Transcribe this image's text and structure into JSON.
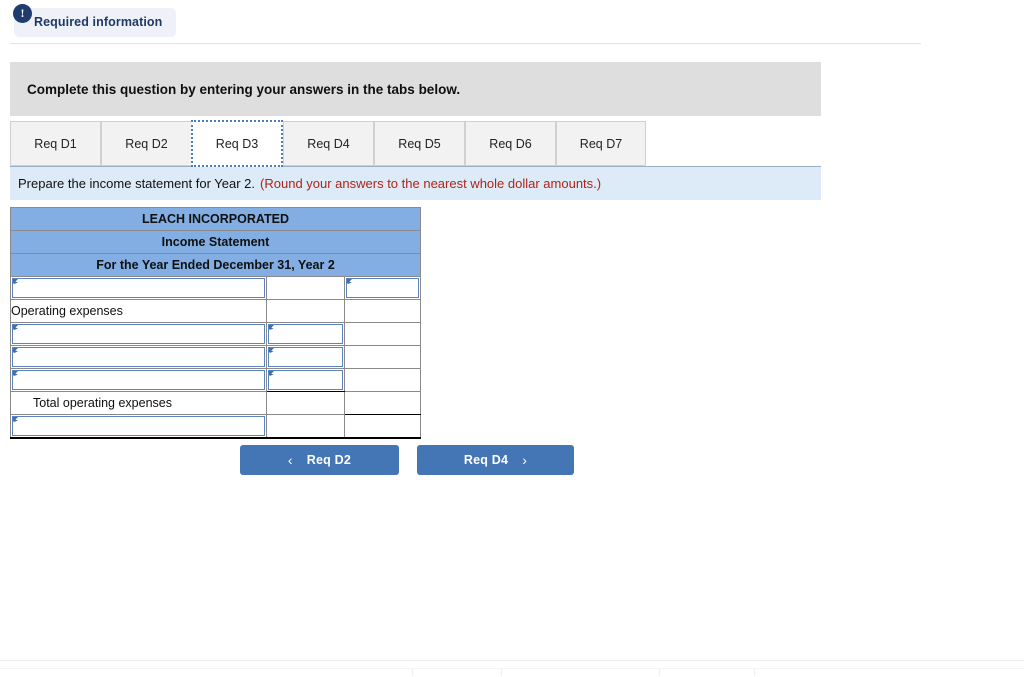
{
  "badge": {
    "icon": "exclamation-icon",
    "icon_glyph": "!",
    "label": "Required information"
  },
  "question_header": {
    "text": "Complete this question by entering your answers in the tabs below."
  },
  "tabs": {
    "active_index": 2,
    "items": [
      {
        "label": "Req D1"
      },
      {
        "label": "Req D2"
      },
      {
        "label": "Req D3"
      },
      {
        "label": "Req D4"
      },
      {
        "label": "Req D5"
      },
      {
        "label": "Req D6"
      },
      {
        "label": "Req D7"
      }
    ]
  },
  "instruction": {
    "main": "Prepare the income statement for Year 2.",
    "note": "(Round your answers to the nearest whole dollar amounts.)"
  },
  "statement": {
    "company": "LEACH INCORPORATED",
    "title": "Income Statement",
    "period": "For the Year Ended December 31, Year 2",
    "rows": [
      {
        "label": "",
        "type": "input-row-1"
      },
      {
        "label": "Operating expenses",
        "type": "text-row"
      },
      {
        "label": "",
        "type": "input-row-2"
      },
      {
        "label": "",
        "type": "input-row-2"
      },
      {
        "label": "",
        "type": "input-row-2-rule"
      },
      {
        "label": "Total operating expenses",
        "type": "total-row"
      },
      {
        "label": "",
        "type": "input-row-final"
      }
    ]
  },
  "navigation": {
    "prev_label": "Req D2",
    "next_label": "Req D4",
    "prev_chevron": "‹",
    "next_chevron": "›"
  },
  "colors": {
    "accent": "#4476b5",
    "table_header": "#82aee3",
    "instruction_bar": "#dcebf7",
    "question_header": "#dedede",
    "note_red": "#b02418",
    "badge_navy": "#1f3c6e"
  }
}
